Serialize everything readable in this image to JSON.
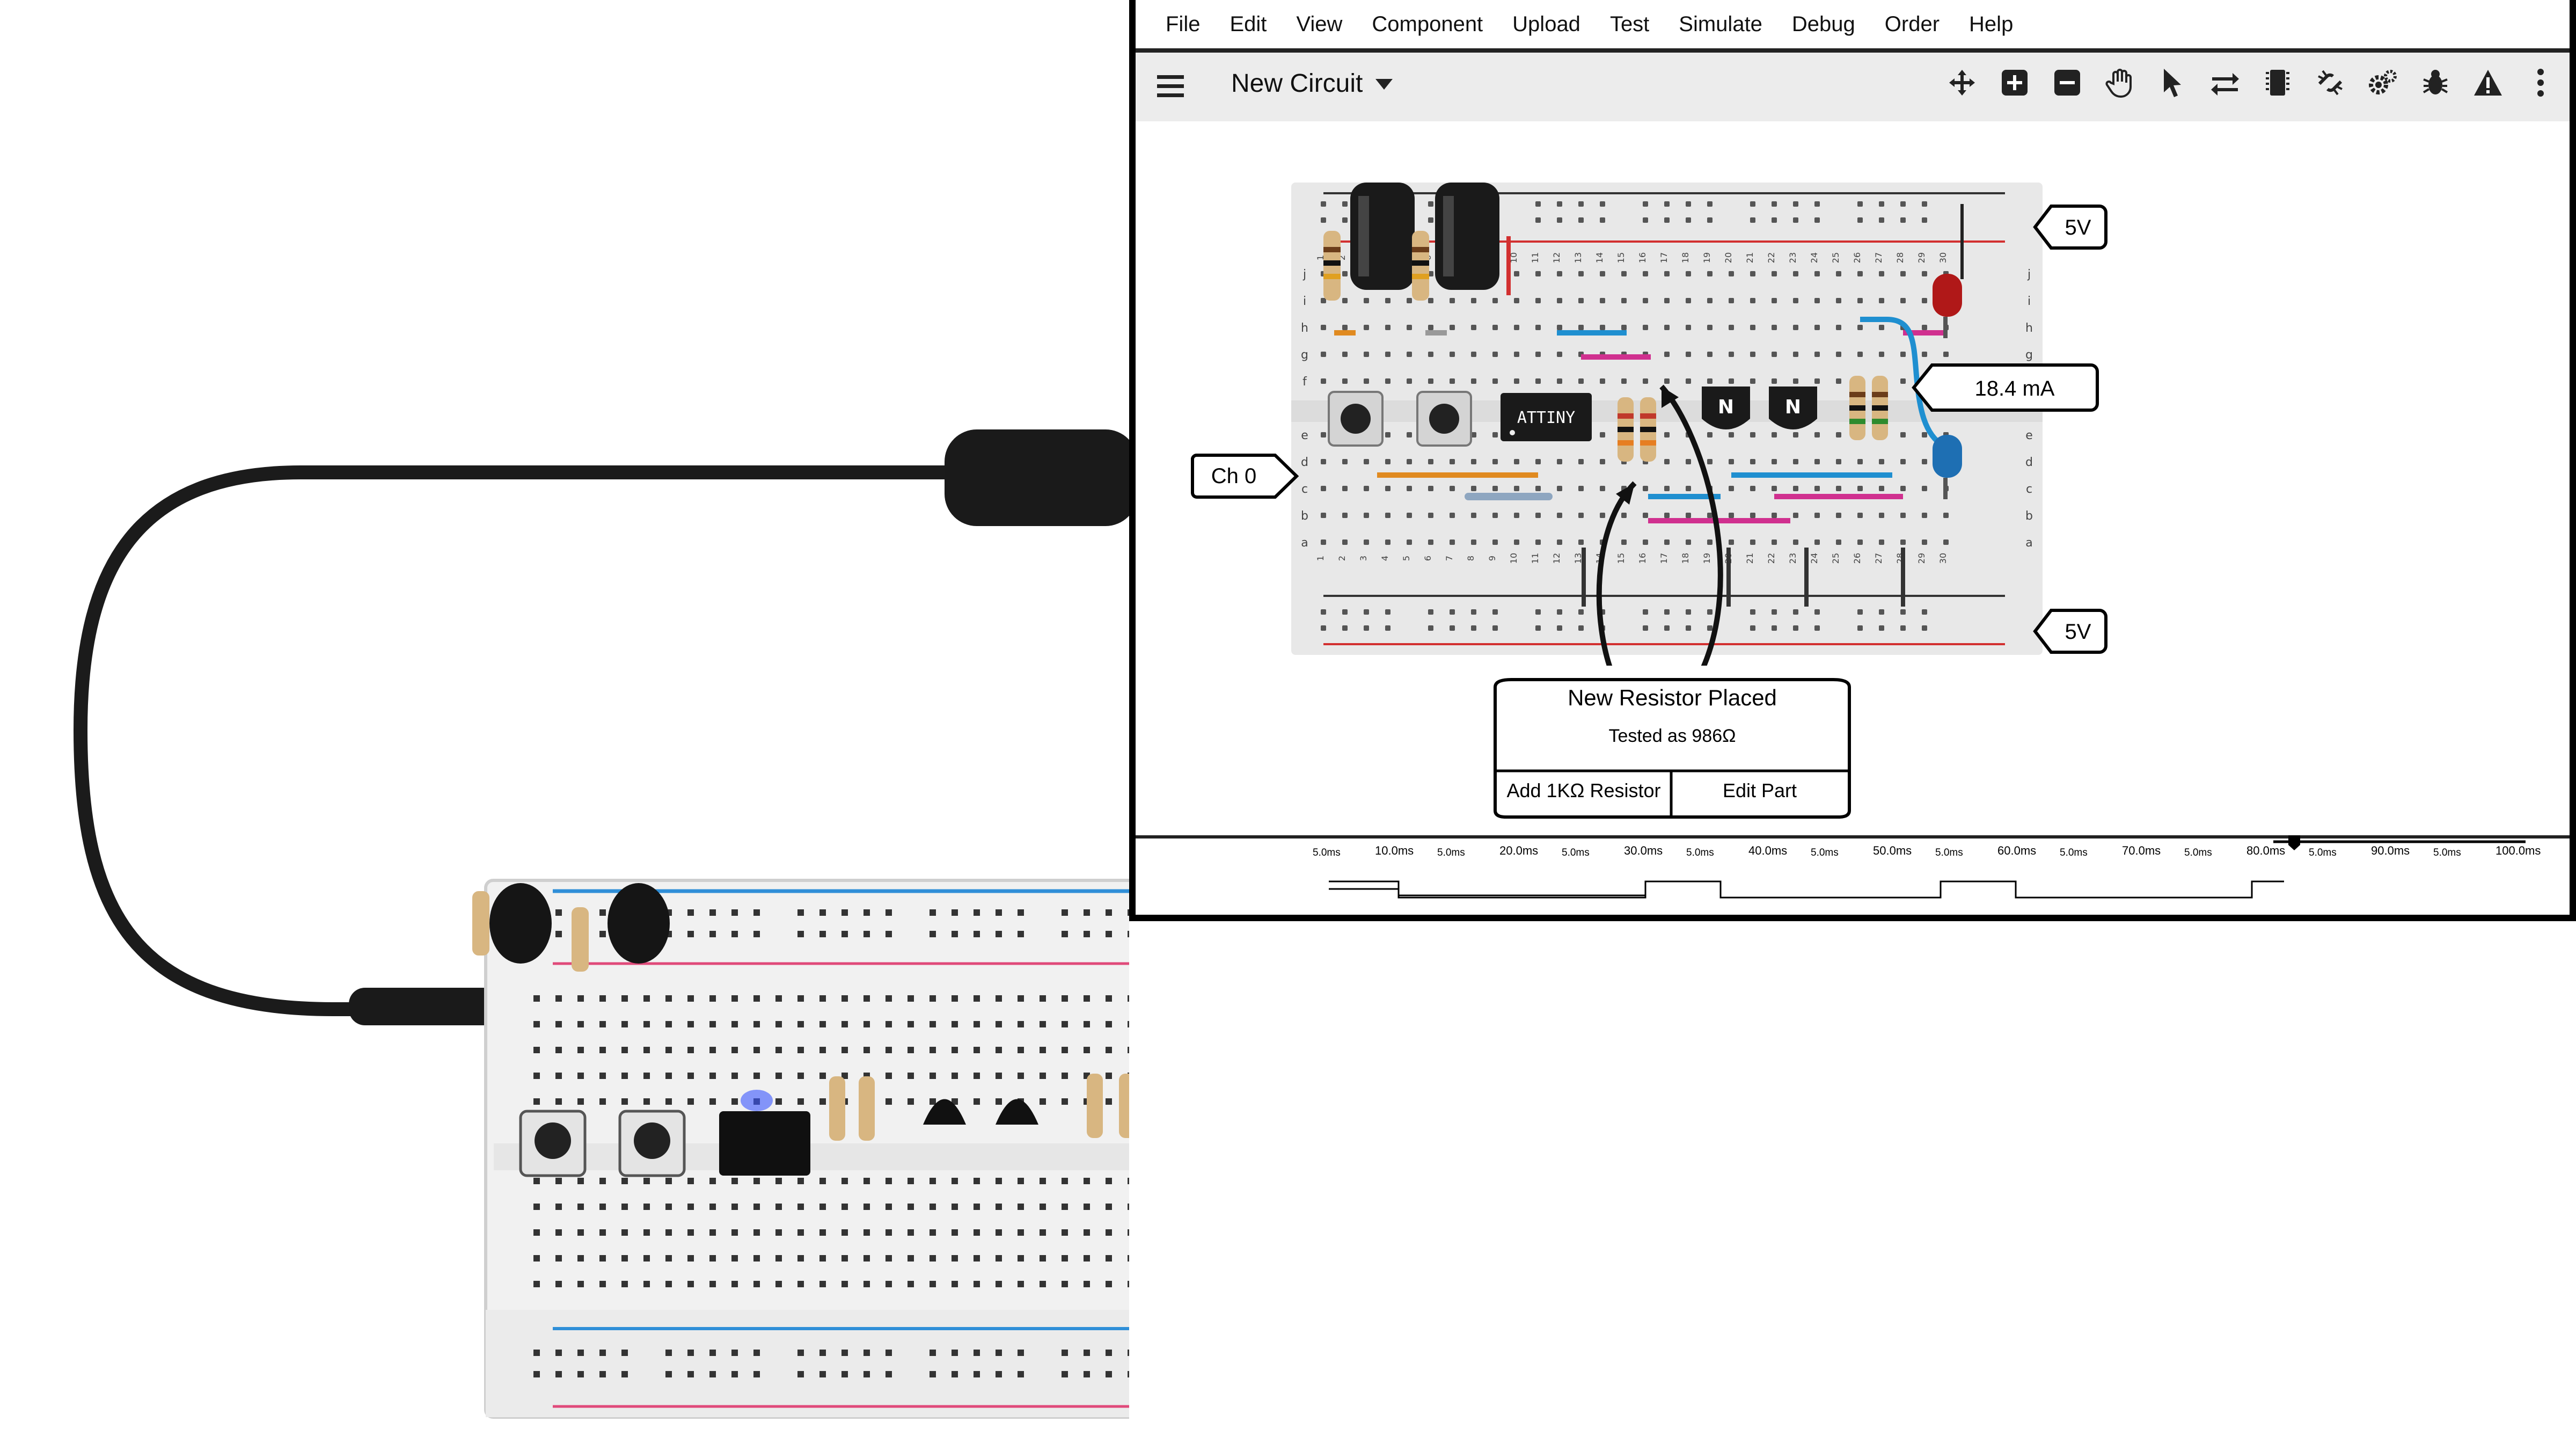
{
  "menu": [
    "File",
    "Edit",
    "View",
    "Component",
    "Upload",
    "Test",
    "Simulate",
    "Debug",
    "Order",
    "Help"
  ],
  "toolbar": {
    "circuit_name": "New Circuit",
    "icons": [
      "move-icon",
      "zoom-in-icon",
      "zoom-out-icon",
      "hand-icon",
      "pointer-icon",
      "swap-icon",
      "chip-icon",
      "disconnect-icon",
      "settings-icon",
      "bug-icon",
      "warning-icon",
      "more-icon"
    ]
  },
  "breadboard_labels": {
    "columns": [
      "1",
      "2",
      "3",
      "4",
      "5",
      "6",
      "7",
      "8",
      "9",
      "10",
      "11",
      "12",
      "13",
      "14",
      "15",
      "16",
      "17",
      "18",
      "19",
      "20",
      "21",
      "22",
      "23",
      "24",
      "25",
      "26",
      "27",
      "28",
      "29",
      "30"
    ],
    "rows_top": [
      "j",
      "i",
      "h",
      "g",
      "f"
    ],
    "rows_bottom": [
      "e",
      "d",
      "c",
      "b",
      "a"
    ]
  },
  "chips": {
    "ic": "ATTINY",
    "transistor1": "N",
    "transistor2": "N"
  },
  "callouts": {
    "top_voltage": "5V",
    "bottom_voltage": "5V",
    "current": "18.4 mA",
    "channel": "Ch 0"
  },
  "dialog": {
    "title": "New Resistor Placed",
    "subtitle": "Tested as 986Ω",
    "left_button": "Add 1KΩ Resistor",
    "right_button": "Edit Part"
  },
  "timeline": {
    "major_ticks": [
      "10.0ms",
      "20.0ms",
      "30.0ms",
      "40.0ms",
      "50.0ms",
      "60.0ms",
      "70.0ms",
      "80.0ms",
      "90.0ms",
      "100.0ms"
    ],
    "minor_tick": "5.0ms",
    "slider_position": 0.05
  },
  "colors": {
    "wire_blue": "#1f8fd0",
    "wire_pink": "#d0308f",
    "wire_orange": "#e08a20",
    "led_red": "#b01818",
    "led_blue": "#1e6fb3",
    "rail_red": "#d23030"
  }
}
